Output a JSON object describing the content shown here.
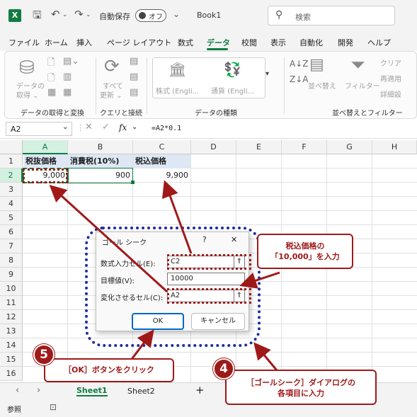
{
  "titlebar": {
    "app_icon": "X",
    "autosave_label": "自動保存",
    "autosave_state": "オフ",
    "book_title": "Book1",
    "search_placeholder": "検索"
  },
  "menu": {
    "tabs": [
      "ファイル",
      "ホーム",
      "挿入",
      "ページ レイアウト",
      "数式",
      "データ",
      "校閲",
      "表示",
      "自動化",
      "開発",
      "ヘルプ"
    ],
    "active_tab": "データ"
  },
  "ribbon": {
    "get_data": "データの",
    "get_data_2": "取得 ⌄",
    "group_get_transform": "データの取得と変換",
    "refresh_all": "すべて",
    "refresh_all_2": "更新 ⌄",
    "group_queries": "クエリと接続",
    "stocks": "株式 (Engli...",
    "currencies": "通貨 (Engli...",
    "group_data_types": "データの種類",
    "sort": "並べ替え",
    "filter": "フィルター",
    "clear": "クリア",
    "reapply": "再適用",
    "advanced": "詳細設",
    "group_sort_filter": "並べ替えとフィルター"
  },
  "formula_bar": {
    "name_box": "A2",
    "fx": "fx",
    "formula": "=A2*0.1"
  },
  "grid": {
    "columns": [
      "A",
      "B",
      "C",
      "D",
      "E",
      "F",
      "G",
      "H"
    ],
    "rows": [
      "1",
      "2",
      "3",
      "4",
      "5",
      "6",
      "7",
      "8",
      "9",
      "10",
      "11",
      "12",
      "13",
      "14",
      "15",
      "16"
    ],
    "cells": {
      "A1": "税抜価格",
      "B1": "消費税(10%)",
      "C1": "税込価格",
      "A2": "9,000",
      "B2": "900",
      "C2": "9,900"
    }
  },
  "sheets": {
    "tabs": [
      "Sheet1",
      "Sheet2"
    ],
    "add": "+"
  },
  "status": {
    "mode": "参照"
  },
  "dialog": {
    "title": "ゴール シーク",
    "help": "?",
    "close": "✕",
    "set_cell_label": "数式入力セル(E):",
    "set_cell_value": "C2",
    "to_value_label": "目標値(V):",
    "to_value_value": "10000",
    "changing_cell_label": "変化させるセル(C):",
    "changing_cell_value": "A2",
    "ok": "OK",
    "cancel": "キャンセル"
  },
  "annotations": {
    "callout_top_1": "税込価格の",
    "callout_top_2": "「10,000」を入力",
    "step5_number": "5",
    "step5_text": "［OK］ボタンをクリック",
    "step4_number": "4",
    "step4_text_1": "［ゴールシーク］ダイアログの",
    "step4_text_2": "各項目に入力",
    "accent_color": "#a01919"
  }
}
